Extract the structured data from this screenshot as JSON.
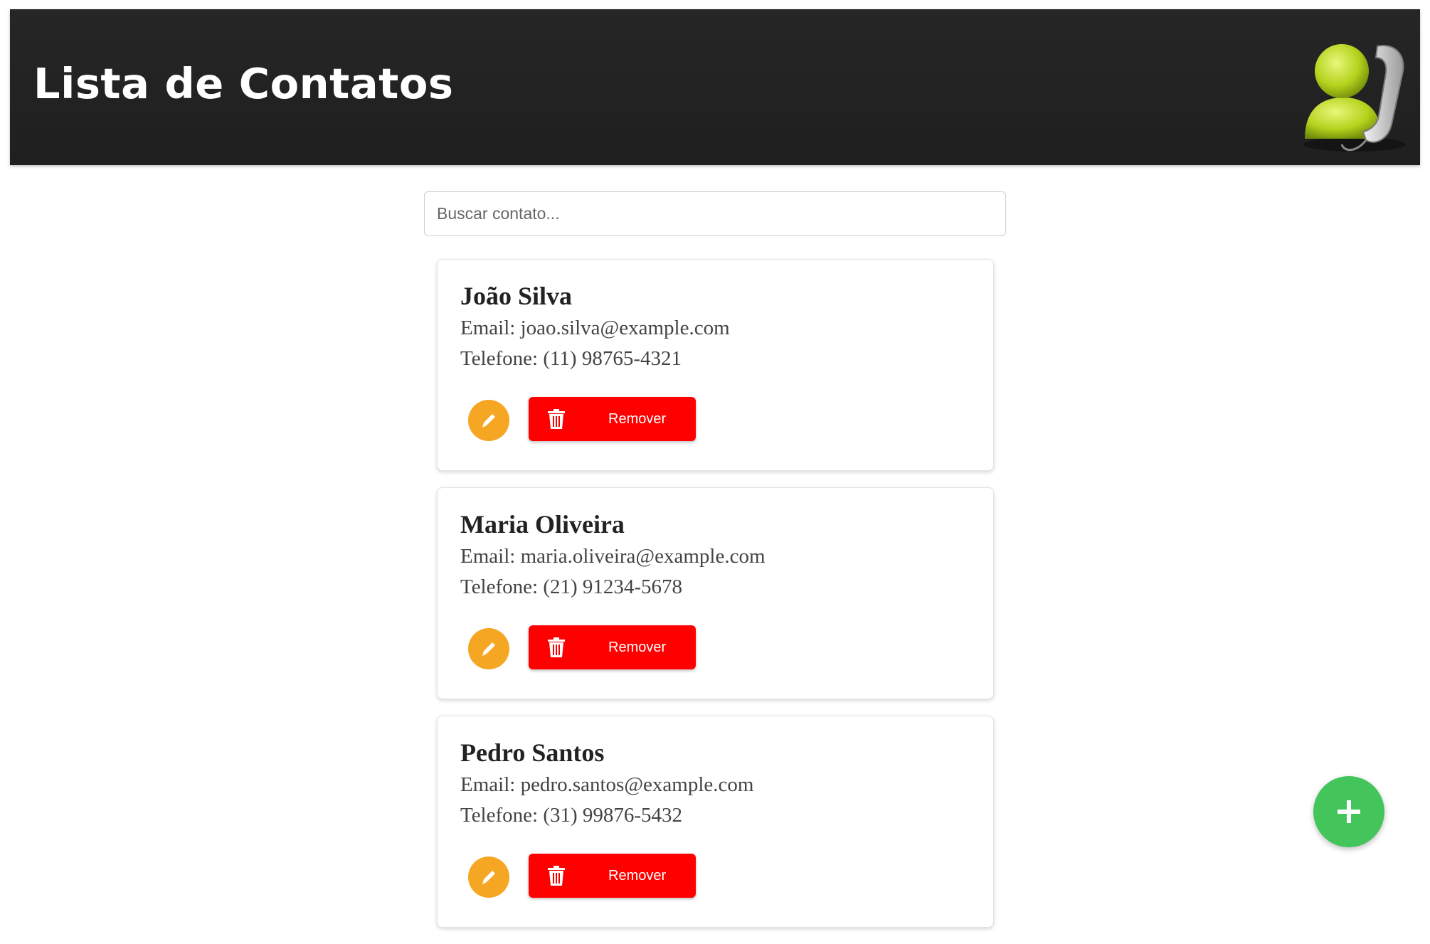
{
  "header": {
    "title": "Lista de Contatos",
    "logo_icon": "contact-phone-logo-icon"
  },
  "search": {
    "placeholder": "Buscar contato...",
    "value": ""
  },
  "contacts": [
    {
      "name": "João Silva",
      "email": "Email: joao.silva@example.com",
      "phone": "Telefone: (11) 98765-4321",
      "remove_label": "Remover"
    },
    {
      "name": "Maria Oliveira",
      "email": "Email: maria.oliveira@example.com",
      "phone": "Telefone: (21) 91234-5678",
      "remove_label": "Remover"
    },
    {
      "name": "Pedro Santos",
      "email": "Email: pedro.santos@example.com",
      "phone": "Telefone: (31) 99876-5432",
      "remove_label": "Remover"
    }
  ],
  "icons": {
    "edit": "pencil-icon",
    "remove": "trash-icon",
    "add": "plus-icon"
  },
  "colors": {
    "header_bg": "#222222",
    "edit": "#f5a623",
    "remove": "#ff0000",
    "add": "#43c55b"
  }
}
